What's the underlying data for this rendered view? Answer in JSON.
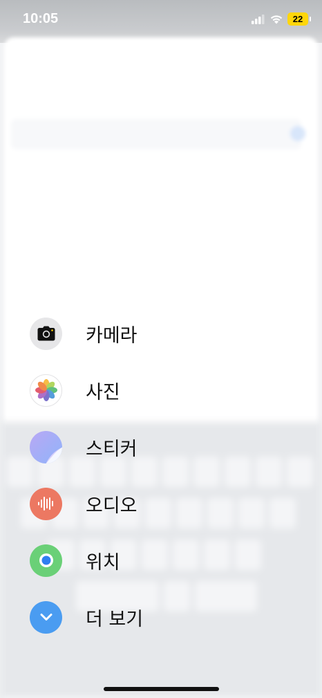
{
  "status_bar": {
    "time": "10:05",
    "battery_level": "22",
    "icons": [
      "cellular-signal-icon",
      "wifi-icon",
      "battery-icon"
    ]
  },
  "menu": {
    "items": [
      {
        "label": "카메라",
        "icon": "camera-icon",
        "color": "#e6e6e8"
      },
      {
        "label": "사진",
        "icon": "photos-icon",
        "color": "#ffffff"
      },
      {
        "label": "스티커",
        "icon": "sticker-icon",
        "color": "#a9aef7"
      },
      {
        "label": "오디오",
        "icon": "audio-waveform-icon",
        "color": "#ec7862"
      },
      {
        "label": "위치",
        "icon": "location-icon",
        "color": "#6ad077"
      },
      {
        "label": "더 보기",
        "icon": "chevron-down-icon",
        "color": "#4a9cf1"
      }
    ]
  }
}
